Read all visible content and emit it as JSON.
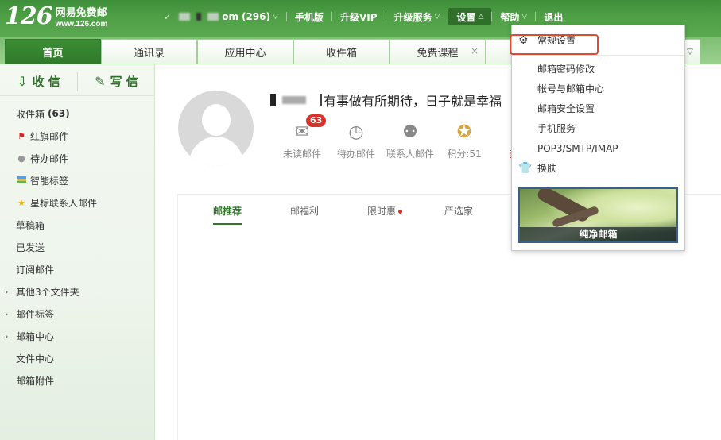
{
  "header": {
    "logo_number": "126",
    "logo_name": "网易免费邮",
    "logo_url": "www.126.com",
    "account_suffix": "om",
    "account_count": "(296)",
    "nav": [
      {
        "label": "手机版"
      },
      {
        "label": "升级VIP"
      },
      {
        "label": "升级服务"
      },
      {
        "label": "设置"
      },
      {
        "label": "帮助"
      },
      {
        "label": "退出"
      }
    ]
  },
  "tabs": [
    {
      "label": "首页"
    },
    {
      "label": "通讯录"
    },
    {
      "label": "应用中心"
    },
    {
      "label": "收件箱"
    },
    {
      "label": "免费课程"
    }
  ],
  "sidebar": {
    "receive_label": "收 信",
    "compose_label": "写 信",
    "folders": [
      {
        "label": "收件箱",
        "count": "(63)"
      },
      {
        "label": "红旗邮件"
      },
      {
        "label": "待办邮件"
      },
      {
        "label": "智能标签"
      },
      {
        "label": "星标联系人邮件"
      },
      {
        "label": "草稿箱"
      },
      {
        "label": "已发送"
      },
      {
        "label": "订阅邮件"
      },
      {
        "label": "其他3个文件夹"
      },
      {
        "label": "邮件标签"
      },
      {
        "label": "邮箱中心"
      },
      {
        "label": "文件中心"
      },
      {
        "label": "邮箱附件"
      }
    ]
  },
  "main": {
    "greeting": "有事做有所期待，日子就是幸福",
    "stats": [
      {
        "label": "未读邮件",
        "badge": "63"
      },
      {
        "label": "待办邮件"
      },
      {
        "label": "联系人邮件"
      },
      {
        "label": "积分:51"
      },
      {
        "label": "安全"
      }
    ],
    "subtabs": [
      {
        "label": "邮推荐"
      },
      {
        "label": "邮福利"
      },
      {
        "label": "限时惠"
      },
      {
        "label": "严选家"
      }
    ]
  },
  "settings_menu": {
    "items": [
      {
        "label": "常规设置"
      },
      {
        "label": "邮箱密码修改"
      },
      {
        "label": "帐号与邮箱中心"
      },
      {
        "label": "邮箱安全设置"
      },
      {
        "label": "手机服务"
      },
      {
        "label": "POP3/SMTP/IMAP"
      },
      {
        "label": "换肤"
      }
    ],
    "skin_label": "纯净邮箱"
  },
  "colors": {
    "brand_green": "#3f8f3a",
    "highlight_red": "#e04a2f",
    "badge_red": "#d8332a"
  }
}
